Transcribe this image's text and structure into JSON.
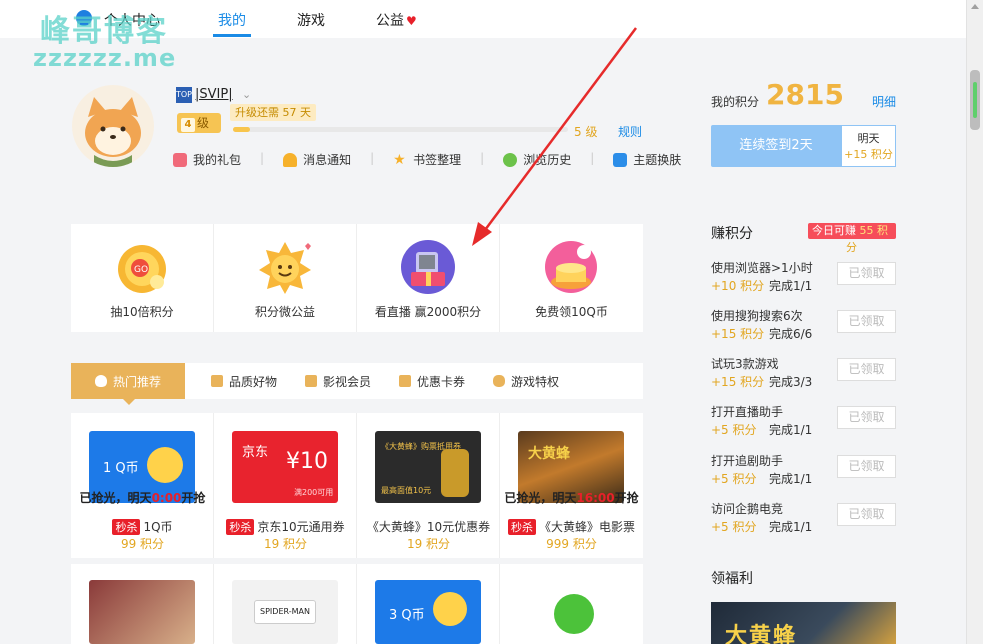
{
  "nav": {
    "personal_center": "个人中心",
    "mine": "我的",
    "games": "游戏",
    "charity": "公益"
  },
  "watermark": {
    "line1": "峰哥博客",
    "line2": "zzzzzz.me"
  },
  "profile": {
    "vip_label": "|SVIP|",
    "level_text": "级",
    "level_number": "4",
    "upgrade_tip": "升级还需 57 天",
    "next_level": "5 级",
    "rules": "规则",
    "progress_fraction": 0.05,
    "quick_links": [
      "我的礼包",
      "消息通知",
      "书签整理",
      "浏览历史",
      "主题换肤"
    ]
  },
  "features": [
    "抽10倍积分",
    "积分微公益",
    "看直播 赢2000积分",
    "免费领10Q币"
  ],
  "tabs": [
    "热门推荐",
    "品质好物",
    "影视会员",
    "优惠卡券",
    "游戏特权"
  ],
  "products": [
    {
      "img_text": "1 Q币",
      "soldout_prefix": "已抢光，明天",
      "soldout_time": "0:00",
      "soldout_suffix": "开抢",
      "sale": "秒杀",
      "name": "1Q币",
      "price": "99 积分"
    },
    {
      "img_text": "京东",
      "img_value": "¥10",
      "img_note": "满200可用",
      "sale": "秒杀",
      "name": "京东10元通用券",
      "price": "19 积分"
    },
    {
      "img_text": "《大黄蜂》购票抵用券",
      "img_note": "最高面值10元",
      "name": "《大黄蜂》10元优惠券",
      "price": "19 积分"
    },
    {
      "img_text": "大黄蜂",
      "soldout_prefix": "已抢光，明天",
      "soldout_time": "16:00",
      "soldout_suffix": "开抢",
      "sale": "秒杀",
      "name": "《大黄蜂》电影票",
      "price": "999 积分"
    }
  ],
  "products_row2": [
    "",
    "SPIDER-MAN",
    "3 Q币",
    ""
  ],
  "points": {
    "label": "我的积分",
    "value": "2815",
    "detail": "明细",
    "checkin": "连续签到2天",
    "tomorrow": "明天",
    "tomorrow_bonus": "+15 积分"
  },
  "earn": {
    "title": "赚积分",
    "badge_prefix": "今日可赚",
    "badge_value": "55 积",
    "badge_tail": "分",
    "tasks": [
      {
        "name": "使用浏览器>1小时",
        "reward": "+10 积分",
        "progress": "完成1/1",
        "button": "已领取"
      },
      {
        "name": "使用搜狗搜索6次",
        "reward": "+15 积分",
        "progress": "完成6/6",
        "button": "已领取"
      },
      {
        "name": "试玩3款游戏",
        "reward": "+15 积分",
        "progress": "完成3/3",
        "button": "已领取"
      },
      {
        "name": "打开直播助手",
        "reward": "+5 积分",
        "progress": "完成1/1",
        "button": "已领取"
      },
      {
        "name": "打开追剧助手",
        "reward": "+5 积分",
        "progress": "完成1/1",
        "button": "已领取"
      },
      {
        "name": "访问企鹅电竞",
        "reward": "+5 积分",
        "progress": "完成1/1",
        "button": "已领取"
      }
    ]
  },
  "welfare": {
    "title": "领福利",
    "banner_text": "大黄蜂"
  },
  "colors": {
    "accent": "#1a8be6",
    "gold": "#f0b441",
    "sale_red": "#e8202a",
    "tab_active": "#e9b35a"
  }
}
